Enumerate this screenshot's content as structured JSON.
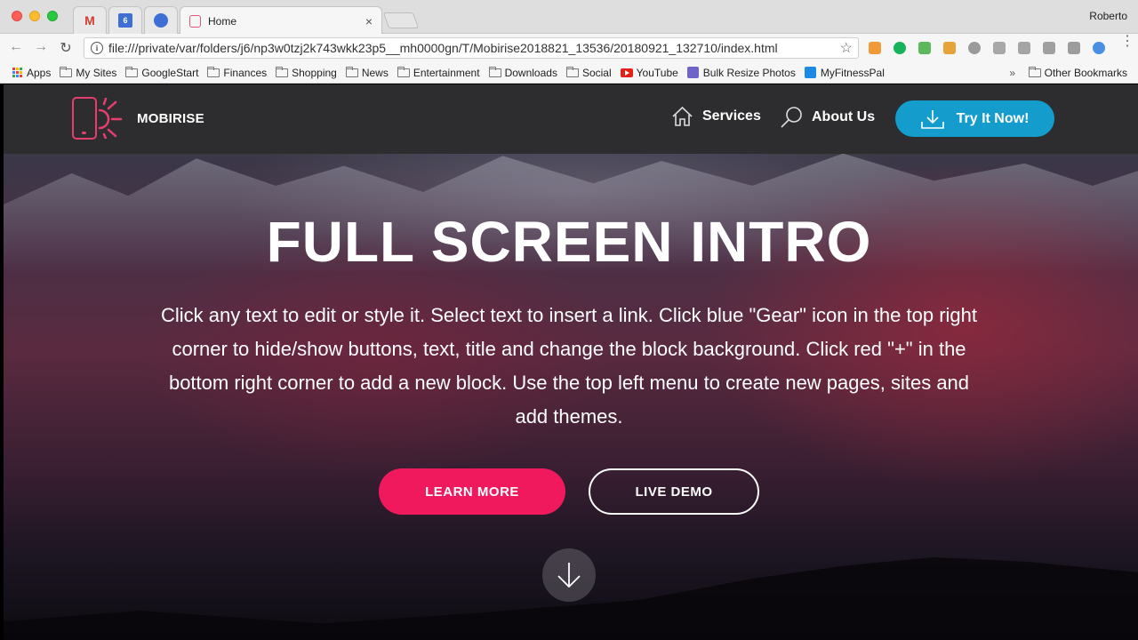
{
  "browser": {
    "tabs": [
      {
        "icon": "gmail-icon",
        "glyph": "M"
      },
      {
        "icon": "calendar-icon",
        "glyph": "6"
      },
      {
        "icon": "contacts-icon",
        "glyph": ""
      },
      {
        "icon": "mobirise-icon",
        "title": "Home",
        "close": "×"
      }
    ],
    "profile": "Roberto",
    "url": "file:///private/var/folders/j6/np3w0tzj2k743wkk23p5__mh0000gn/T/Mobirise2018821_13536/20180921_132710/index.html",
    "bookmarks": [
      {
        "label": "Apps",
        "icon": "apps-grid-icon"
      },
      {
        "label": "My Sites",
        "icon": "folder-icon"
      },
      {
        "label": "GoogleStart",
        "icon": "folder-icon"
      },
      {
        "label": "Finances",
        "icon": "folder-icon"
      },
      {
        "label": "Shopping",
        "icon": "folder-icon"
      },
      {
        "label": "News",
        "icon": "folder-icon"
      },
      {
        "label": "Entertainment",
        "icon": "folder-icon"
      },
      {
        "label": "Downloads",
        "icon": "folder-icon"
      },
      {
        "label": "Social",
        "icon": "folder-icon"
      },
      {
        "label": "YouTube",
        "icon": "youtube-icon"
      },
      {
        "label": "Bulk Resize Photos",
        "icon": "bulk-resize-icon"
      },
      {
        "label": "MyFitnessPal",
        "icon": "myfitnesspal-icon"
      }
    ],
    "more": "»",
    "other_bookmarks": "Other Bookmarks"
  },
  "site": {
    "brand": "MOBIRISE",
    "nav": [
      {
        "label": "Services",
        "icon": "home-icon"
      },
      {
        "label": "About Us",
        "icon": "search-icon"
      }
    ],
    "cta": "Try It Now!",
    "hero": {
      "title": "FULL SCREEN INTRO",
      "text": "Click any text to edit or style it. Select text to insert a link. Click blue \"Gear\" icon in the top right corner to hide/show buttons, text, title and change the block background. Click red \"+\" in the bottom right corner to add a new block. Use the top left menu to create new pages, sites and add themes.",
      "primary_button": "LEARN MORE",
      "secondary_button": "LIVE DEMO"
    }
  },
  "colors": {
    "accent_pink": "#f0195e",
    "accent_blue": "#149dcc",
    "logo_red": "#e43f6f",
    "navbar_bg": "#2d2d2f"
  }
}
